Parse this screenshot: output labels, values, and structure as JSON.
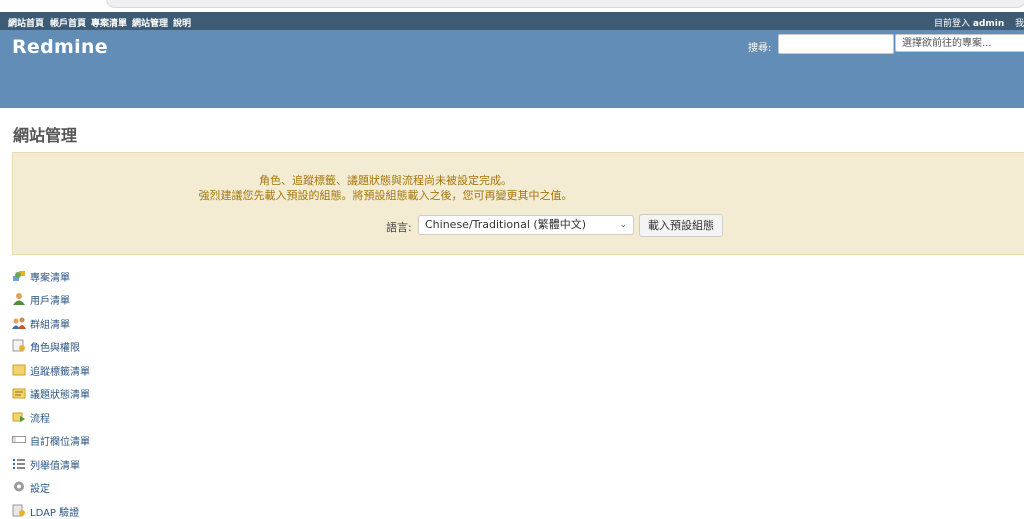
{
  "top_menu": {
    "items": [
      "網站首頁",
      "帳戶首頁",
      "專案清單",
      "網站管理",
      "說明"
    ],
    "logged_in_prefix": "目前登入",
    "logged_in_user": "admin",
    "my_account_partial": "我的"
  },
  "header": {
    "title": "Redmine",
    "search_label": "搜尋:",
    "search_value": "",
    "project_jump_placeholder": "選擇欲前往的專案..."
  },
  "page_title": "網站管理",
  "flash": {
    "line1": "角色、追蹤標籤、議題狀態與流程尚未被設定完成。",
    "line2": "強烈建議您先載入預設的組態。將預設組態載入之後，您可再變更其中之值。",
    "language_label": "語言:",
    "language_selected": "Chinese/Traditional (繁體中文)",
    "load_button": "載入預設組態"
  },
  "admin_menu": [
    {
      "label": "專案清單",
      "icon": "projects-icon"
    },
    {
      "label": "用戶清單",
      "icon": "user-icon"
    },
    {
      "label": "群組清單",
      "icon": "group-icon"
    },
    {
      "label": "角色與權限",
      "icon": "roles-icon"
    },
    {
      "label": "追蹤標籤清單",
      "icon": "tracker-icon"
    },
    {
      "label": "議題狀態清單",
      "icon": "issue-status-icon"
    },
    {
      "label": "流程",
      "icon": "workflow-icon"
    },
    {
      "label": "自訂欄位清單",
      "icon": "custom-field-icon"
    },
    {
      "label": "列舉值清單",
      "icon": "list-icon"
    },
    {
      "label": "設定",
      "icon": "gear-icon"
    },
    {
      "label": "LDAP 驗證",
      "icon": "ldap-icon"
    }
  ],
  "colors": {
    "top_menu_bg": "#3e5b76",
    "header_bg": "#628db6",
    "flash_bg": "#f3ecd2",
    "flash_text": "#a6750c",
    "link": "#2a5685"
  }
}
